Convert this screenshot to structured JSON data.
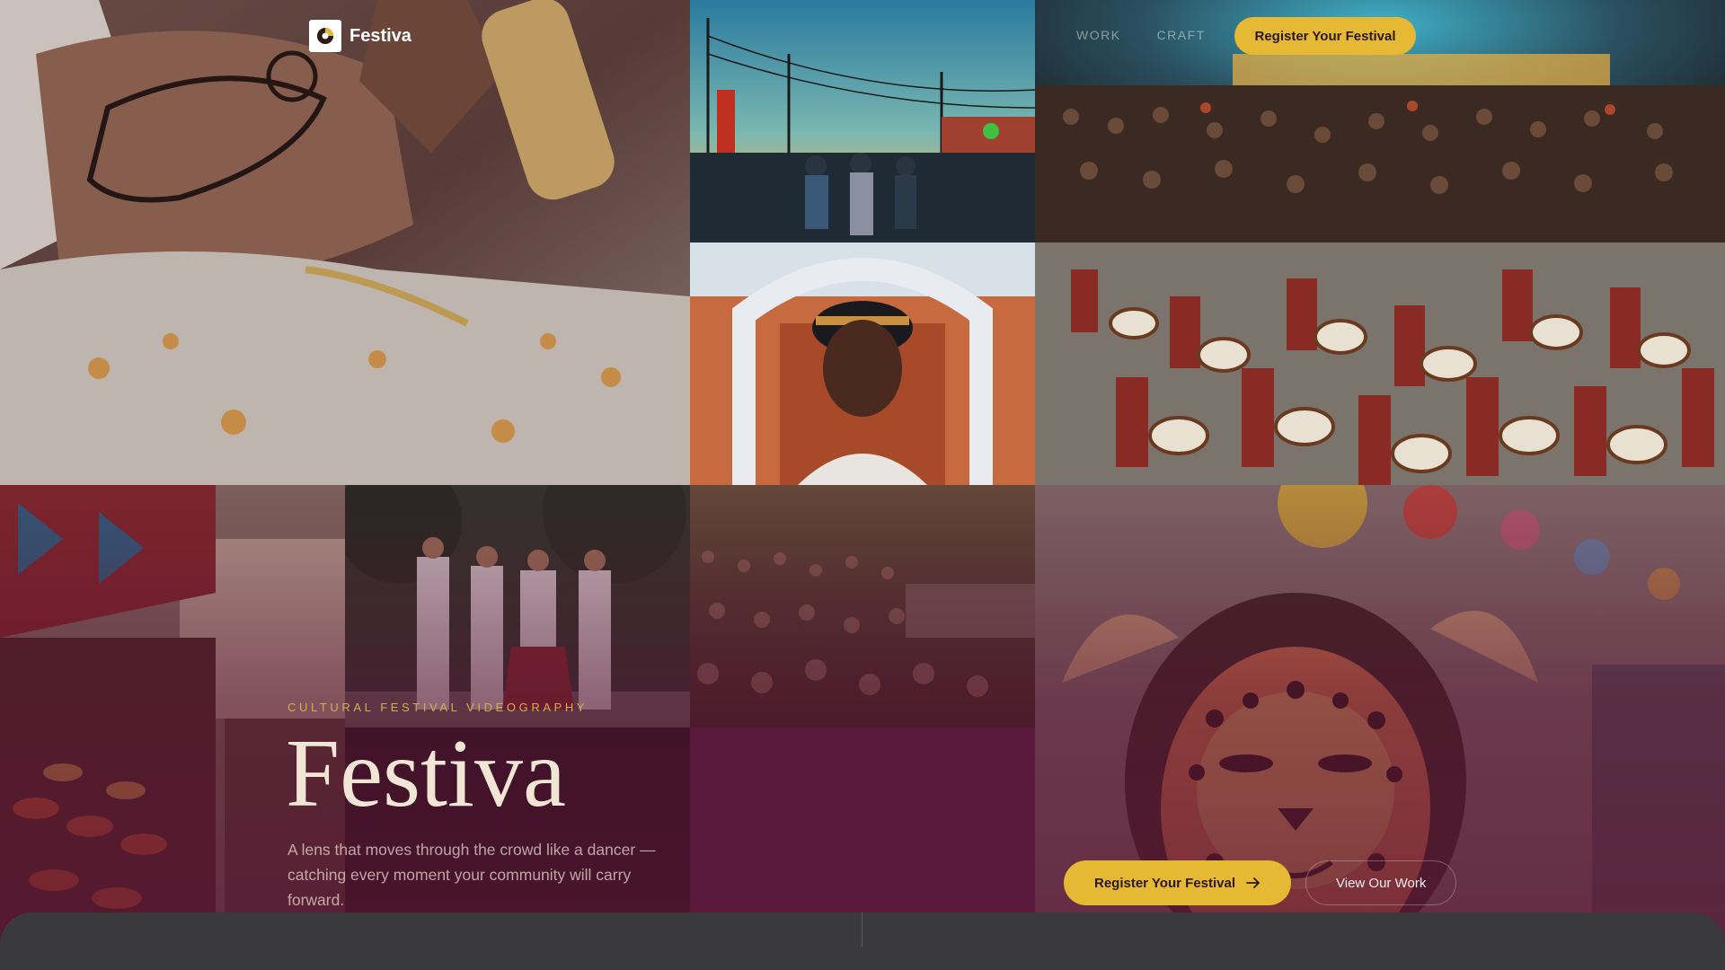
{
  "brand": {
    "name": "Festiva"
  },
  "nav": {
    "items": [
      "WORK",
      "CRAFT"
    ],
    "cta_label": "Register Your Festival"
  },
  "hero": {
    "eyebrow": "CULTURAL FESTIVAL VIDEOGRAPHY",
    "title": "Festiva",
    "description": "A lens that moves through the crowd like a dancer — catching every moment your community will carry forward.",
    "primary_cta": "Register Your Festival",
    "primary_cta_icon": "arrow-right-icon",
    "secondary_cta": "View Our Work"
  },
  "gallery": {
    "photos": [
      "henna-hands-photo",
      "street-festival-dusk-photo",
      "concert-crowd-photo",
      "smiling-woman-portrait-photo",
      "drummers-parade-photo",
      "spice-market-photo",
      "folk-dancers-photo",
      "amphitheater-crowd-photo",
      "leopard-face-paint-child-photo"
    ]
  },
  "colors": {
    "accent_gold": "#e6b934",
    "plum": "#5b1a3c",
    "eyebrow_gold": "#d8ae52",
    "title_cream": "#f1e6d6",
    "sheet_gray": "#3a3a3d"
  }
}
